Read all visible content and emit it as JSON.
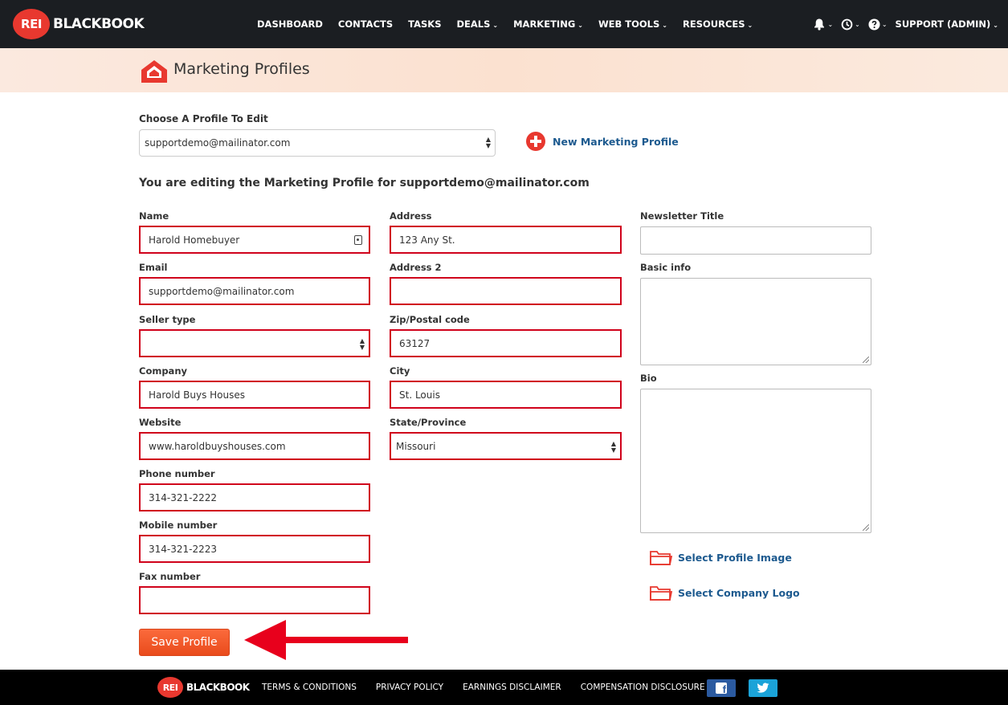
{
  "brand": {
    "logo_badge": "REI",
    "logo_text": "BLACKBOOK"
  },
  "nav": {
    "items": [
      {
        "label": "DASHBOARD",
        "caret": false
      },
      {
        "label": "CONTACTS",
        "caret": false
      },
      {
        "label": "TASKS",
        "caret": false
      },
      {
        "label": "DEALS",
        "caret": true
      },
      {
        "label": "MARKETING",
        "caret": true
      },
      {
        "label": "WEB TOOLS",
        "caret": true
      },
      {
        "label": "RESOURCES",
        "caret": true
      }
    ],
    "user_label": "SUPPORT (ADMIN)",
    "caret_glyph": "⌄",
    "icons": [
      "bell-icon",
      "clock-icon",
      "help-icon"
    ]
  },
  "header": {
    "title": "Marketing Profiles"
  },
  "chooser": {
    "label": "Choose A Profile To Edit",
    "selected": "supportdemo@mailinator.com",
    "new_profile_label": "New Marketing Profile"
  },
  "editing_title": "You are editing the Marketing Profile for supportdemo@mailinator.com",
  "form": {
    "name": {
      "label": "Name",
      "value": "Harold Homebuyer"
    },
    "email": {
      "label": "Email",
      "value": "supportdemo@mailinator.com"
    },
    "seller_type": {
      "label": "Seller type",
      "value": ""
    },
    "company": {
      "label": "Company",
      "value": "Harold Buys Houses"
    },
    "website": {
      "label": "Website",
      "value": "www.haroldbuyshouses.com"
    },
    "phone": {
      "label": "Phone number",
      "value": "314-321-2222"
    },
    "mobile": {
      "label": "Mobile number",
      "value": "314-321-2223"
    },
    "fax": {
      "label": "Fax number",
      "value": ""
    },
    "address": {
      "label": "Address",
      "value": "123 Any St."
    },
    "address2": {
      "label": "Address 2",
      "value": ""
    },
    "zip": {
      "label": "Zip/Postal code",
      "value": "63127"
    },
    "city": {
      "label": "City",
      "value": "St. Louis"
    },
    "state": {
      "label": "State/Province",
      "value": "Missouri"
    },
    "newsletter_title": {
      "label": "Newsletter Title",
      "value": ""
    },
    "basic_info": {
      "label": "Basic info",
      "value": ""
    },
    "bio": {
      "label": "Bio",
      "value": ""
    }
  },
  "uploads": {
    "profile_image_label": "Select Profile Image",
    "company_logo_label": "Select Company Logo"
  },
  "save_label": "Save Profile",
  "footer": {
    "logo_badge": "REI",
    "logo_text": "BLACKBOOK",
    "links": [
      "TERMS & CONDITIONS",
      "PRIVACY POLICY",
      "EARNINGS DISCLAIMER",
      "COMPENSATION DISCLOSURE"
    ],
    "social": [
      "facebook-icon",
      "twitter-icon"
    ]
  },
  "colors": {
    "nav_bg": "#1b1e22",
    "brand_red": "#e8382f",
    "required_border": "#d0021b",
    "link_blue": "#1d5a8f",
    "save_orange": "#f0562a",
    "annotation_red": "#e8001c"
  }
}
